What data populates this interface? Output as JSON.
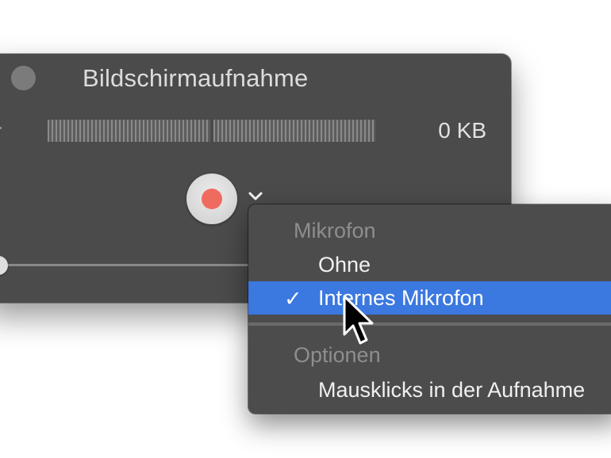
{
  "window": {
    "title": "Bildschirmaufnahme",
    "file_size": "0 KB",
    "record_color": "#f06b5f"
  },
  "menu": {
    "sections": [
      {
        "header": "Mikrofon",
        "items": [
          {
            "label": "Ohne",
            "selected": false
          },
          {
            "label": "Internes Mikrofon",
            "selected": true
          }
        ]
      },
      {
        "header": "Optionen",
        "items": [
          {
            "label": "Mausklicks in der Aufnahme",
            "selected": false
          }
        ]
      }
    ],
    "checkmark": "✓",
    "highlight_color": "#3b78e0"
  },
  "icons": {
    "traffic_light": "close-window-icon",
    "chevron": "chevron-down-icon",
    "cursor": "mouse-pointer-icon"
  }
}
